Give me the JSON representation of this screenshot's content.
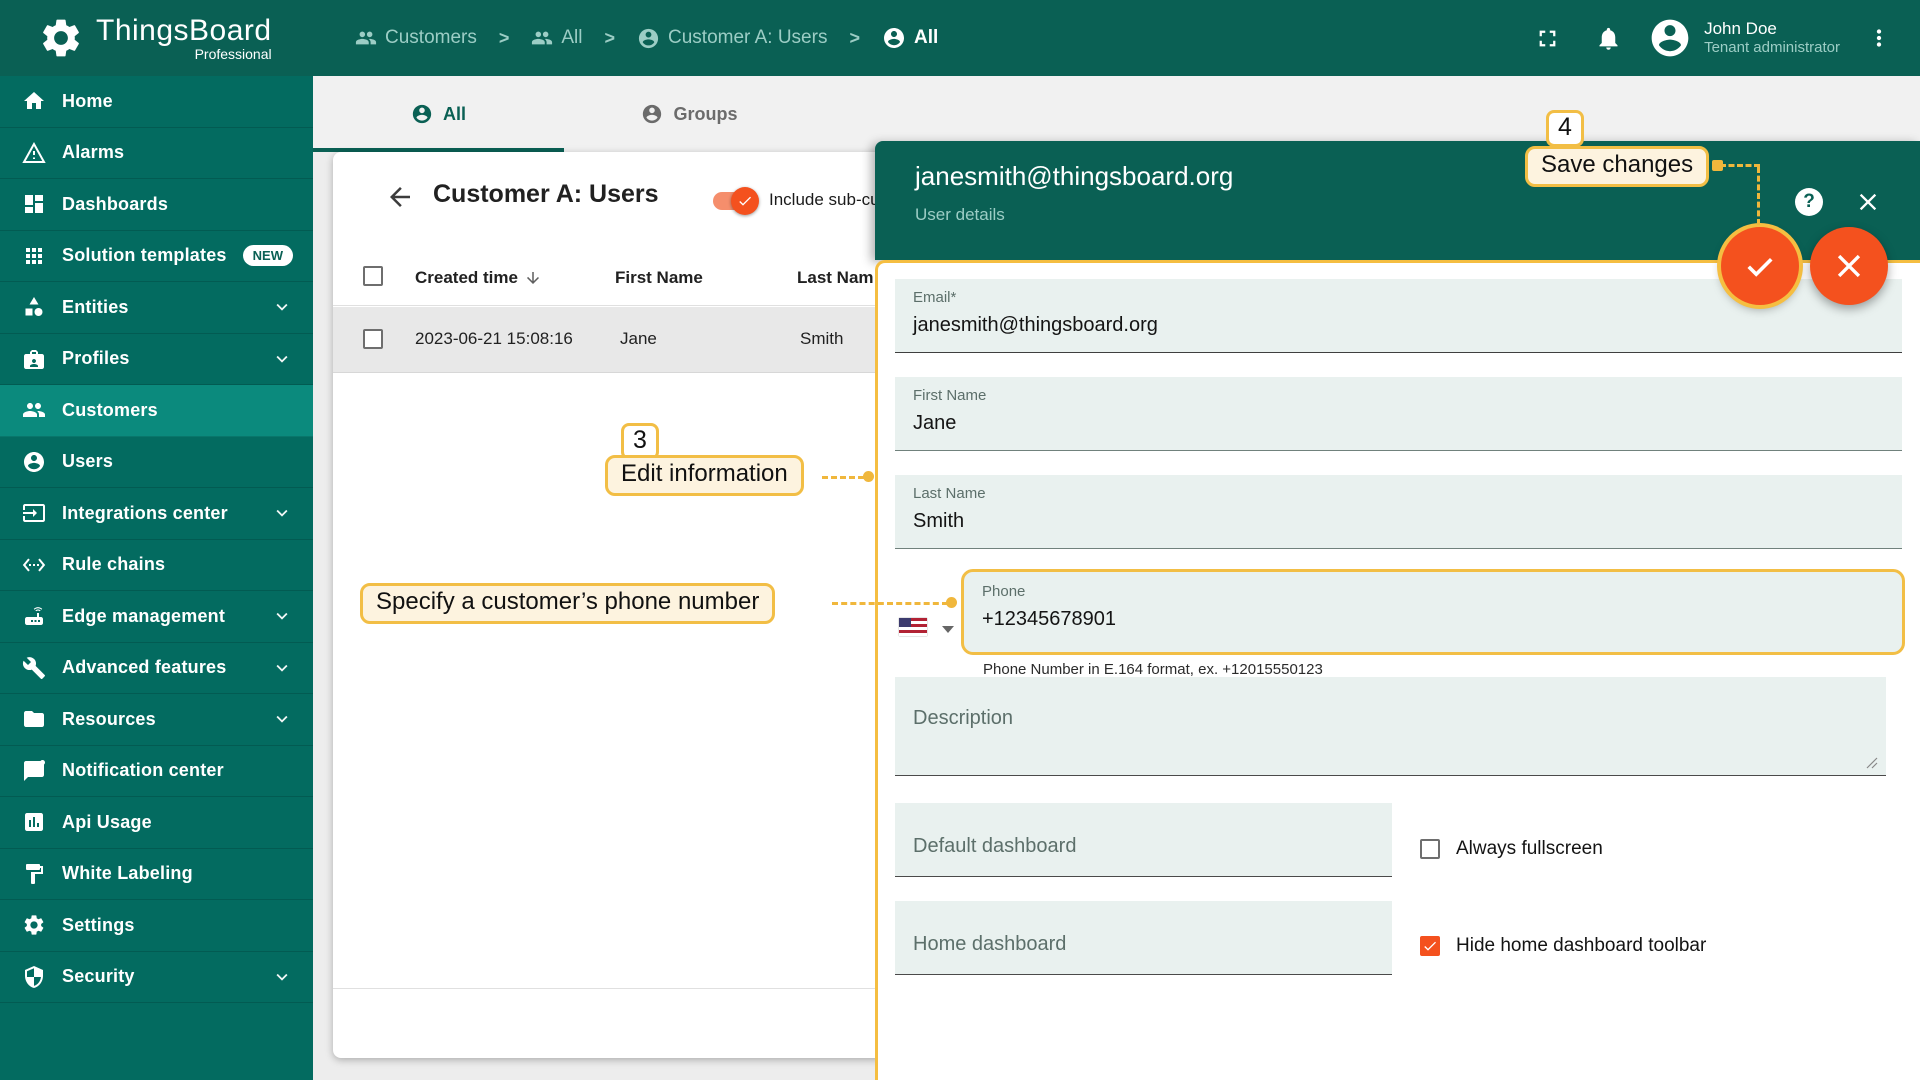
{
  "app": {
    "name": "ThingsBoard",
    "edition": "Professional"
  },
  "topbar": {
    "separator": ">",
    "breadcrumbs": [
      {
        "label": "Customers",
        "icon": "people-icon"
      },
      {
        "label": "All",
        "icon": "people-icon"
      },
      {
        "label": "Customer A: Users",
        "icon": "person-icon"
      },
      {
        "label": "All",
        "icon": "person-icon"
      }
    ],
    "user": {
      "name": "John Doe",
      "role": "Tenant administrator"
    }
  },
  "sidebar": {
    "items": [
      {
        "label": "Home",
        "icon": "home-icon"
      },
      {
        "label": "Alarms",
        "icon": "warning-icon"
      },
      {
        "label": "Dashboards",
        "icon": "dashboards-icon"
      },
      {
        "label": "Solution templates",
        "icon": "grid-icon",
        "badge": "NEW"
      },
      {
        "label": "Entities",
        "icon": "shapes-icon",
        "expandable": true
      },
      {
        "label": "Profiles",
        "icon": "badge-icon",
        "expandable": true
      },
      {
        "label": "Customers",
        "icon": "people-icon",
        "active": true
      },
      {
        "label": "Users",
        "icon": "person-icon"
      },
      {
        "label": "Integrations center",
        "icon": "input-icon",
        "expandable": true
      },
      {
        "label": "Rule chains",
        "icon": "ethernet-icon"
      },
      {
        "label": "Edge management",
        "icon": "router-icon",
        "expandable": true
      },
      {
        "label": "Advanced features",
        "icon": "wrench-icon",
        "expandable": true
      },
      {
        "label": "Resources",
        "icon": "folder-icon",
        "expandable": true
      },
      {
        "label": "Notification center",
        "icon": "chat-icon"
      },
      {
        "label": "Api Usage",
        "icon": "chart-icon"
      },
      {
        "label": "White Labeling",
        "icon": "paint-icon"
      },
      {
        "label": "Settings",
        "icon": "gear-icon"
      },
      {
        "label": "Security",
        "icon": "shield-icon",
        "expandable": true
      }
    ]
  },
  "tabs": {
    "all": "All",
    "groups": "Groups"
  },
  "users_table": {
    "title": "Customer A: Users",
    "toggle_label": "Include sub-cu",
    "columns": {
      "created_time": "Created time",
      "first_name": "First Name",
      "last_name": "Last Nam"
    },
    "rows": [
      {
        "created_time": "2023-06-21 15:08:16",
        "first_name": "Jane",
        "last_name": "Smith"
      }
    ]
  },
  "details_panel": {
    "title": "janesmith@thingsboard.org",
    "subtitle": "User details",
    "help_glyph": "?",
    "email": {
      "label": "Email*",
      "value": "janesmith@thingsboard.org"
    },
    "first_name": {
      "label": "First Name",
      "value": "Jane"
    },
    "last_name": {
      "label": "Last Name",
      "value": "Smith"
    },
    "phone": {
      "label": "Phone",
      "value": "+12345678901",
      "hint": "Phone Number in E.164 format, ex. +12015550123"
    },
    "description": {
      "placeholder": "Description"
    },
    "default_dashboard": {
      "placeholder": "Default dashboard"
    },
    "home_dashboard": {
      "placeholder": "Home dashboard"
    },
    "always_fullscreen": {
      "label": "Always fullscreen",
      "checked": false
    },
    "hide_toolbar": {
      "label": "Hide home dashboard toolbar",
      "checked": true
    }
  },
  "annotations": {
    "step3": {
      "number": "3",
      "label": "Edit information"
    },
    "step4": {
      "number": "4",
      "label": "Save changes"
    },
    "phone_tip": {
      "label": "Specify a customer’s phone number"
    }
  },
  "colors": {
    "topbar": "#0A6054",
    "sidebar": "#036B60",
    "sidebar_active": "#0B8A7D",
    "accent_orange": "#F4511E",
    "annotation_yellow": "#F2BE45",
    "field_bg": "#E9F1EF"
  }
}
